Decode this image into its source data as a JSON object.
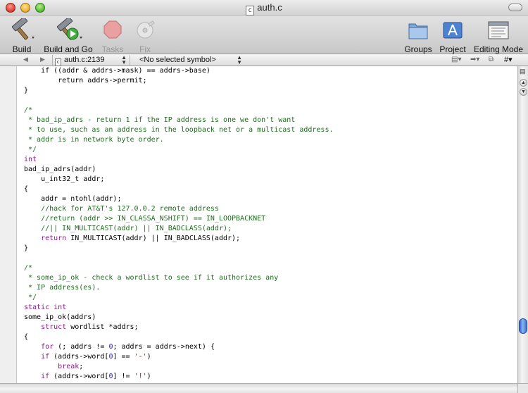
{
  "window": {
    "title": "auth.c",
    "file_badge": "c"
  },
  "toolbar": {
    "build_label": "Build",
    "build_and_go_label": "Build and Go",
    "tasks_label": "Tasks",
    "fix_label": "Fix",
    "groups_label": "Groups",
    "project_label": "Project",
    "editing_mode_label": "Editing Mode"
  },
  "navbar": {
    "file_position": "auth.c:2139",
    "symbol": "<No selected symbol>",
    "counterpart_label": "#"
  },
  "editor": {
    "lines": [
      [
        {
          "t": "    if ((addr & addrs->mask) == addrs->base)"
        }
      ],
      [
        {
          "t": "        return addrs->permit;"
        }
      ],
      [
        {
          "t": "}"
        }
      ],
      [
        {
          "t": ""
        }
      ],
      [
        {
          "t": "/*",
          "c": "cm"
        }
      ],
      [
        {
          "t": " * bad_ip_adrs - return 1 if the IP address is one we don't want",
          "c": "cm"
        }
      ],
      [
        {
          "t": " * to use, such as an address in the loopback net or a multicast address.",
          "c": "cm"
        }
      ],
      [
        {
          "t": " * addr is in network byte order.",
          "c": "cm"
        }
      ],
      [
        {
          "t": " */",
          "c": "cm"
        }
      ],
      [
        {
          "t": "int",
          "c": "kw"
        }
      ],
      [
        {
          "t": "bad_ip_adrs(addr)"
        }
      ],
      [
        {
          "t": "    u_int32_t addr;"
        }
      ],
      [
        {
          "t": "{"
        }
      ],
      [
        {
          "t": "    addr = ntohl(addr);"
        }
      ],
      [
        {
          "t": "    //hack for AT&T's 127.0.0.2 remote address",
          "c": "cm"
        }
      ],
      [
        {
          "t": "    //return (addr >> IN_CLASSA_NSHIFT) == IN_LOOPBACKNET",
          "c": "cm"
        }
      ],
      [
        {
          "t": "    //|| IN_MULTICAST(addr) || IN_BADCLASS(addr);",
          "c": "cm"
        }
      ],
      [
        {
          "t": "    "
        },
        {
          "t": "return",
          "c": "kw"
        },
        {
          "t": " IN_MULTICAST(addr) || IN_BADCLASS(addr);"
        }
      ],
      [
        {
          "t": "}"
        }
      ],
      [
        {
          "t": ""
        }
      ],
      [
        {
          "t": "/*",
          "c": "cm"
        }
      ],
      [
        {
          "t": " * some_ip_ok - check a wordlist to see if it authorizes any",
          "c": "cm"
        }
      ],
      [
        {
          "t": " * IP address(es).",
          "c": "cm"
        }
      ],
      [
        {
          "t": " */",
          "c": "cm"
        }
      ],
      [
        {
          "t": "static",
          "c": "kw"
        },
        {
          "t": " "
        },
        {
          "t": "int",
          "c": "kw"
        }
      ],
      [
        {
          "t": "some_ip_ok(addrs)"
        }
      ],
      [
        {
          "t": "    "
        },
        {
          "t": "struct",
          "c": "kw"
        },
        {
          "t": " wordlist *addrs;"
        }
      ],
      [
        {
          "t": "{"
        }
      ],
      [
        {
          "t": "    "
        },
        {
          "t": "for",
          "c": "kw"
        },
        {
          "t": " (; addrs != "
        },
        {
          "t": "0",
          "c": "nm"
        },
        {
          "t": "; addrs = addrs->next) {"
        }
      ],
      [
        {
          "t": "    "
        },
        {
          "t": "if",
          "c": "kw"
        },
        {
          "t": " (addrs->word["
        },
        {
          "t": "0",
          "c": "nm"
        },
        {
          "t": "] == "
        },
        {
          "t": "'-'",
          "c": "st"
        },
        {
          "t": ")"
        }
      ],
      [
        {
          "t": "        "
        },
        {
          "t": "break",
          "c": "kw"
        },
        {
          "t": ";"
        }
      ],
      [
        {
          "t": "    "
        },
        {
          "t": "if",
          "c": "kw"
        },
        {
          "t": " (addrs->word["
        },
        {
          "t": "0",
          "c": "nm"
        },
        {
          "t": "] != "
        },
        {
          "t": "'!'",
          "c": "st"
        },
        {
          "t": ")"
        }
      ]
    ]
  },
  "colors": {
    "comment": "#1f6b1f",
    "keyword": "#8b1a8b",
    "number": "#2020c8",
    "string": "#b01010",
    "scroll_thumb": "#3a74d8"
  },
  "icons": {
    "build": "hammer-icon",
    "build_and_go": "hammer-play-icon",
    "tasks": "stop-sign-icon",
    "fix": "disk-fix-icon",
    "groups": "folder-icon",
    "project": "app-project-icon",
    "editing_mode": "editing-mode-icon"
  }
}
